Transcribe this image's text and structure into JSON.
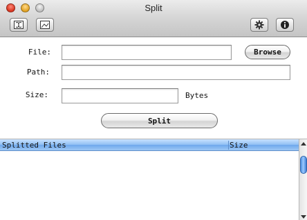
{
  "window": {
    "title": "Split"
  },
  "toolbar": {
    "left_icons": [
      "split-doc-icon",
      "image-doc-icon"
    ],
    "right_icons": [
      "gear-icon",
      "info-icon"
    ]
  },
  "form": {
    "file_label": "File:",
    "file_value": "",
    "browse_label": "Browse",
    "path_label": "Path:",
    "path_value": "",
    "size_label": "Size:",
    "size_value": "",
    "size_unit": "Bytes",
    "split_label": "Split"
  },
  "table": {
    "columns": [
      "Splitted Files",
      "Size"
    ],
    "rows": []
  },
  "colors": {
    "header_blue": "#8fbff3",
    "scroll_thumb": "#4a8fe0"
  }
}
